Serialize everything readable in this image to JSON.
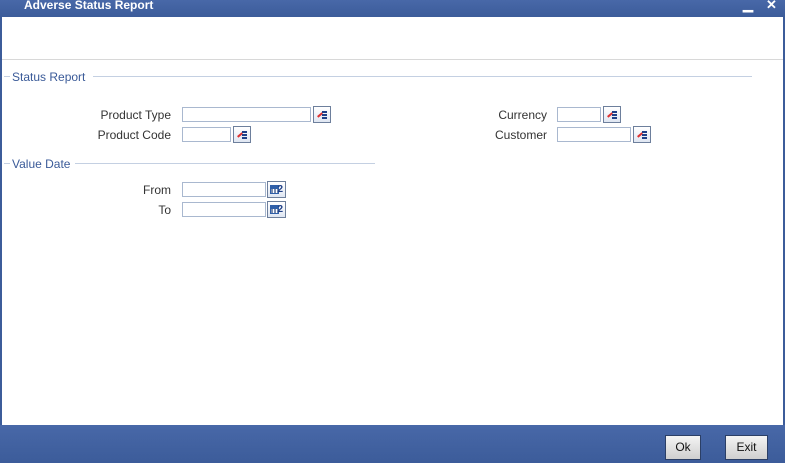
{
  "window": {
    "title": "Adverse Status Report"
  },
  "sections": {
    "status_report": "Status Report",
    "value_date": "Value Date"
  },
  "fields": {
    "product_type": {
      "label": "Product Type",
      "value": ""
    },
    "product_code": {
      "label": "Product Code",
      "value": ""
    },
    "currency": {
      "label": "Currency",
      "value": ""
    },
    "customer": {
      "label": "Customer",
      "value": ""
    },
    "from": {
      "label": "From",
      "value": ""
    },
    "to": {
      "label": "To",
      "value": ""
    }
  },
  "calendar_glyph": "2",
  "buttons": {
    "ok": "Ok",
    "exit": "Exit"
  },
  "icons": {
    "minimize": "minimize-icon",
    "close": "close-icon",
    "lov": "list-of-values-icon",
    "calendar": "calendar-icon"
  },
  "colors": {
    "titlebar": "#3c5c9a",
    "section_text": "#3a5a98"
  }
}
